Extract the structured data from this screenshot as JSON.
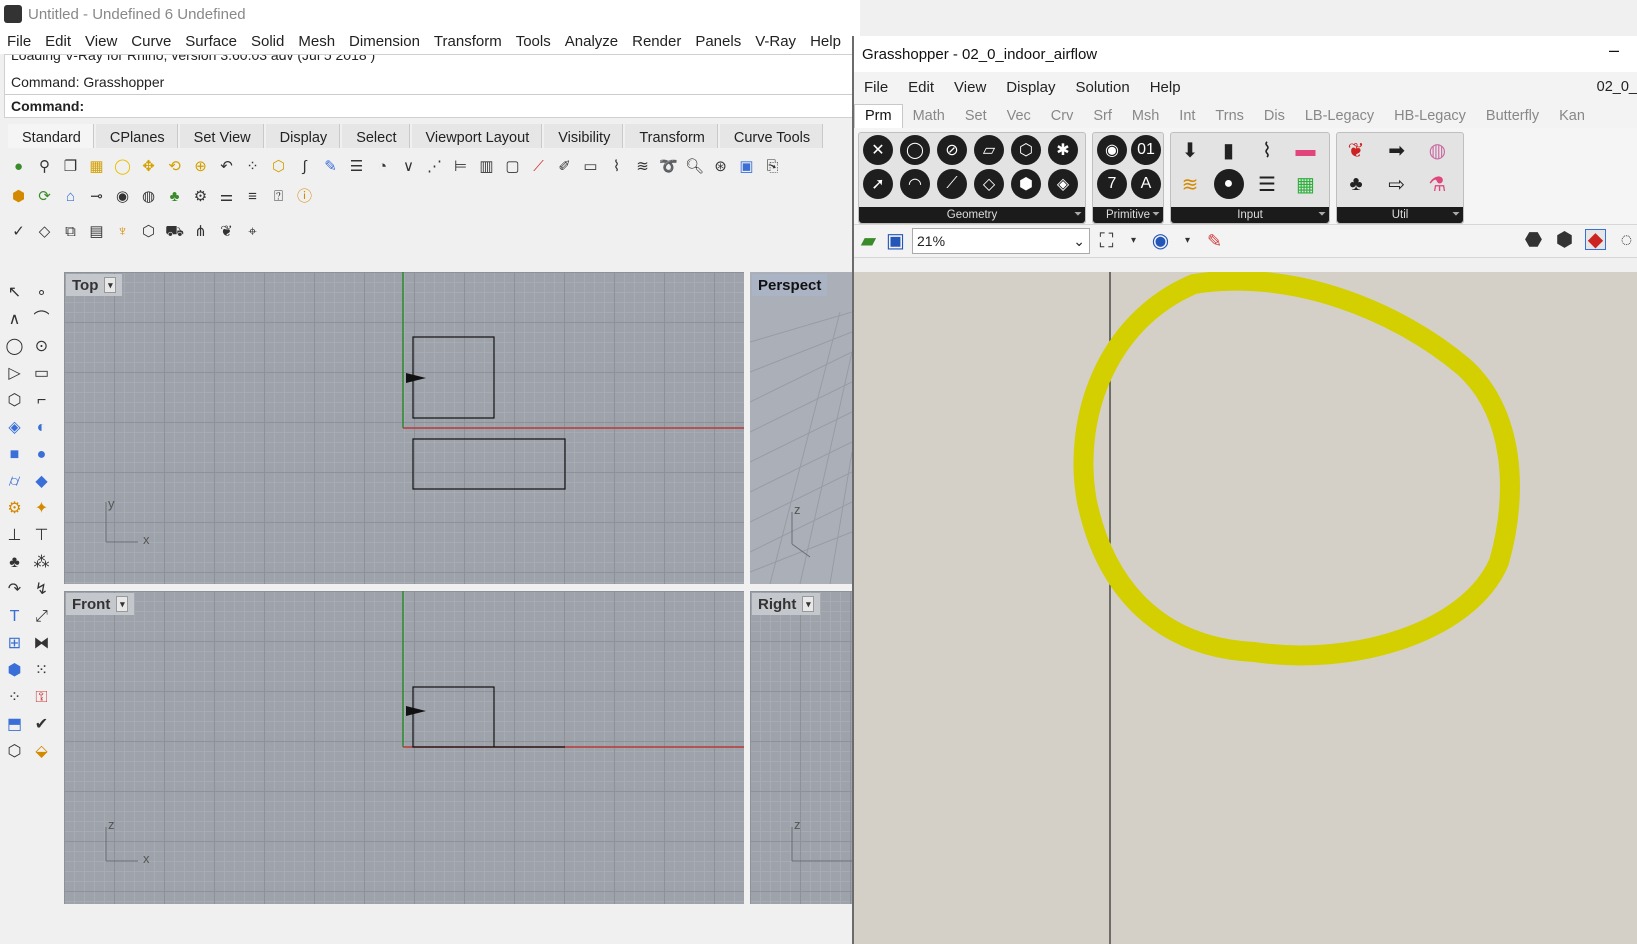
{
  "rhino": {
    "title": "Untitled - Undefined 6 Undefined",
    "menu": [
      "File",
      "Edit",
      "View",
      "Curve",
      "Surface",
      "Solid",
      "Mesh",
      "Dimension",
      "Transform",
      "Tools",
      "Analyze",
      "Render",
      "Panels",
      "V-Ray",
      "Help"
    ],
    "command_history_1": "Loading V-Ray for Rhino, version 3.60.03 adv (Jul  5 2018 )",
    "command_history_2": "Command: Grasshopper",
    "command_prompt": "Command:",
    "toolbar_tabs": [
      "Standard",
      "CPlanes",
      "Set View",
      "Display",
      "Select",
      "Viewport Layout",
      "Visibility",
      "Transform",
      "Curve Tools"
    ],
    "viewports": {
      "top": "Top",
      "front": "Front",
      "perspective": "Perspect",
      "right": "Right"
    },
    "axes": {
      "x": "x",
      "y": "y",
      "z": "z"
    }
  },
  "grasshopper": {
    "title": "Grasshopper - 02_0_indoor_airflow",
    "minimize": "–",
    "menu": [
      "File",
      "Edit",
      "View",
      "Display",
      "Solution",
      "Help"
    ],
    "document_name": "02_0_",
    "tabs": [
      "Prm",
      "Math",
      "Set",
      "Vec",
      "Crv",
      "Srf",
      "Msh",
      "Int",
      "Trns",
      "Dis",
      "LB-Legacy",
      "HB-Legacy",
      "Butterfly",
      "Kan"
    ],
    "active_tab": "Prm",
    "panels": [
      "Geometry",
      "Primitive",
      "Input",
      "Util"
    ],
    "zoom": "21%",
    "canvas_color": "#d4d0c8",
    "sketch_color": "#d4cf00"
  },
  "icons": {
    "dropdown": "▾",
    "expand": "⏷"
  }
}
